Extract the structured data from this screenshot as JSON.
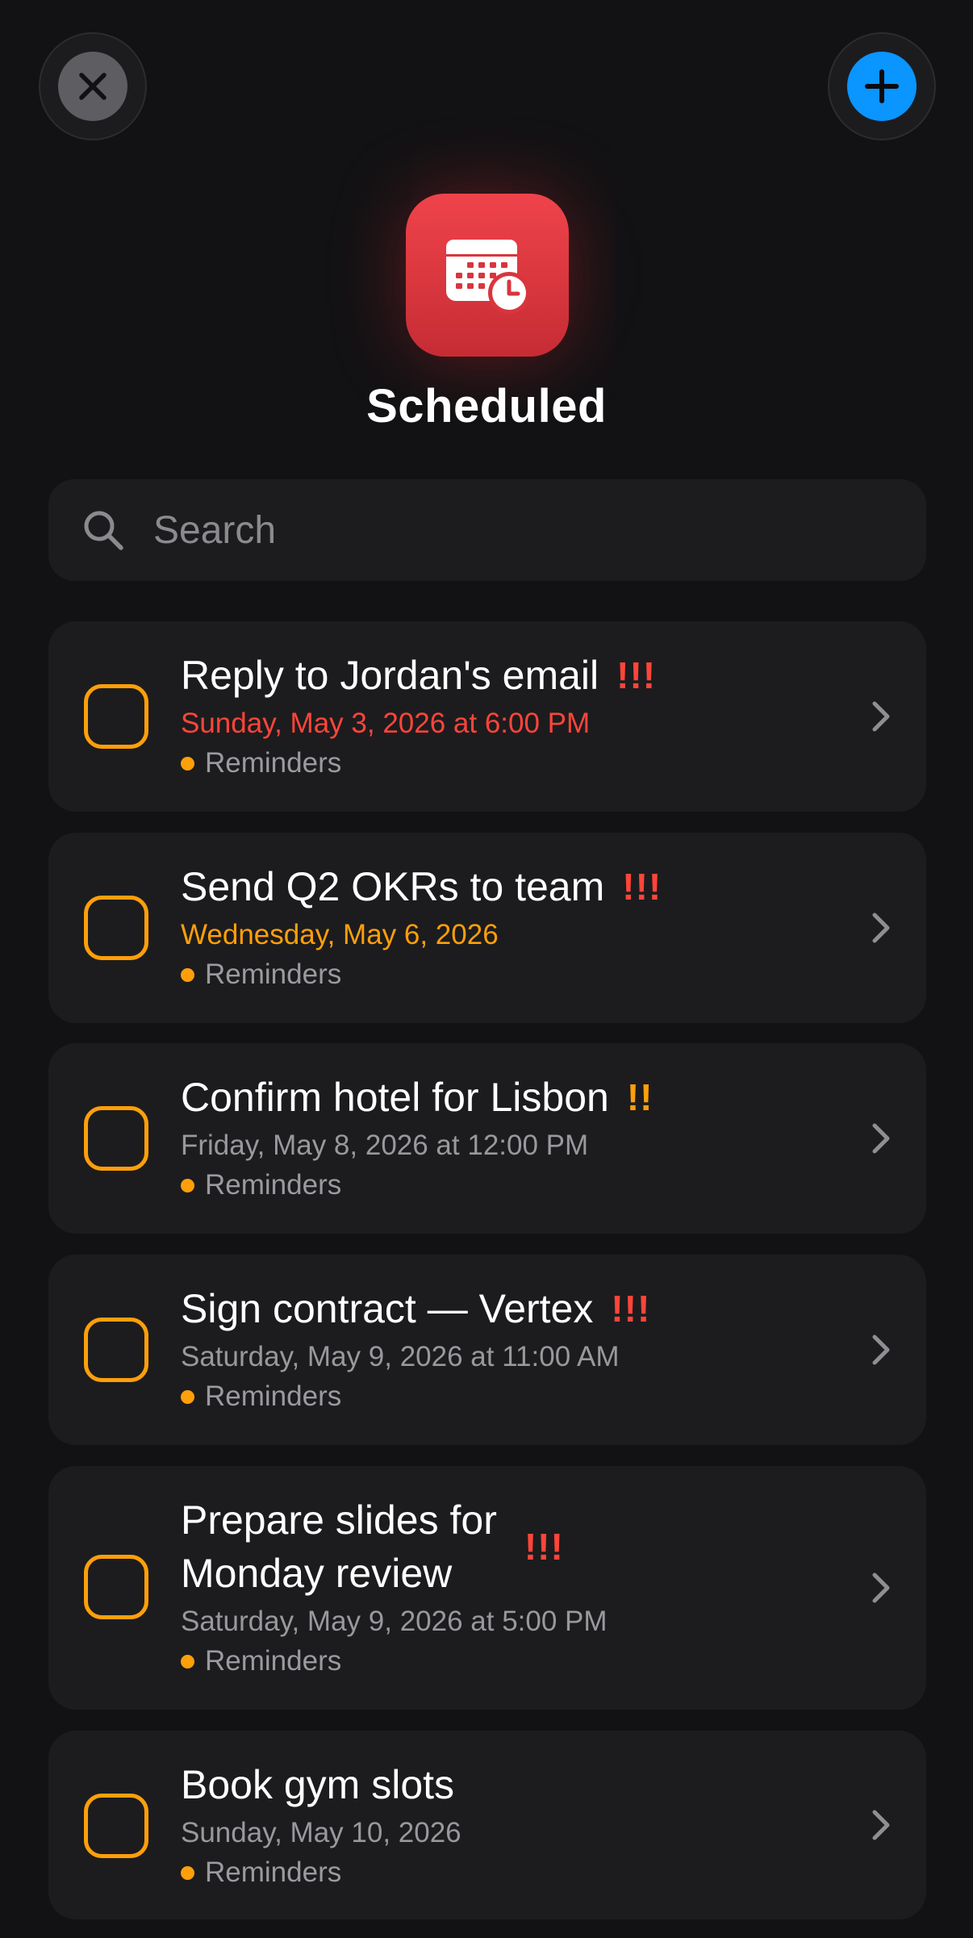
{
  "header": {
    "title": "Scheduled",
    "search_placeholder": "Search",
    "accent_color": "#0a95ff",
    "list_icon": "calendar-clock-icon"
  },
  "reminders": [
    {
      "title": "Reply to Jordan's email",
      "priority": "!!!",
      "priority_color": "#ff453a",
      "date": "Sunday, May 3, 2026 at 6:00 PM",
      "date_color": "#ff453a",
      "list": "Reminders"
    },
    {
      "title": "Send Q2 OKRs to team",
      "priority": "!!!",
      "priority_color": "#ff453a",
      "date": "Wednesday, May 6, 2026",
      "date_color": "#ff9f0a",
      "list": "Reminders"
    },
    {
      "title": "Confirm hotel for Lisbon",
      "priority": "!!",
      "priority_color": "#ff9f0a",
      "date": "Friday, May 8, 2026 at 12:00 PM",
      "date_color": "#98989d",
      "list": "Reminders"
    },
    {
      "title": "Sign contract — Vertex",
      "priority": "!!!",
      "priority_color": "#ff453a",
      "date": "Saturday, May 9, 2026 at 11:00 AM",
      "date_color": "#98989d",
      "list": "Reminders"
    },
    {
      "title_line1": "Prepare slides for",
      "title_line2": "Monday review",
      "priority": "!!!",
      "priority_color": "#ff453a",
      "date": "Saturday, May 9, 2026 at 5:00 PM",
      "date_color": "#98989d",
      "list": "Reminders"
    },
    {
      "title": "Book gym slots",
      "date": "Sunday, May 10, 2026",
      "date_color": "#98989d",
      "list": "Reminders"
    }
  ]
}
